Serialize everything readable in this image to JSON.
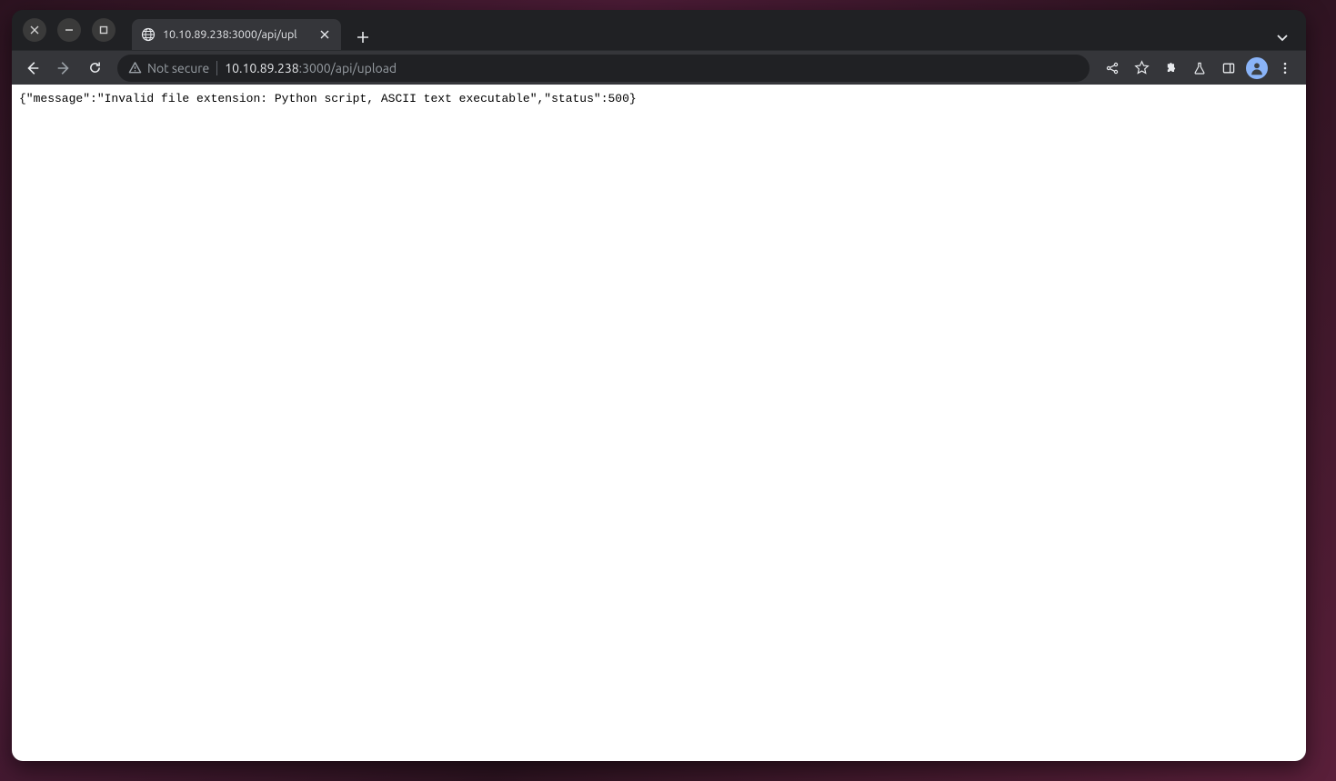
{
  "tab": {
    "title": "10.10.89.238:3000/api/upl"
  },
  "addressbar": {
    "security_label": "Not secure",
    "url_host": "10.10.89.238",
    "url_rest": ":3000/api/upload"
  },
  "response_text": "{\"message\":\"Invalid file extension: Python script, ASCII text executable\",\"status\":500}"
}
